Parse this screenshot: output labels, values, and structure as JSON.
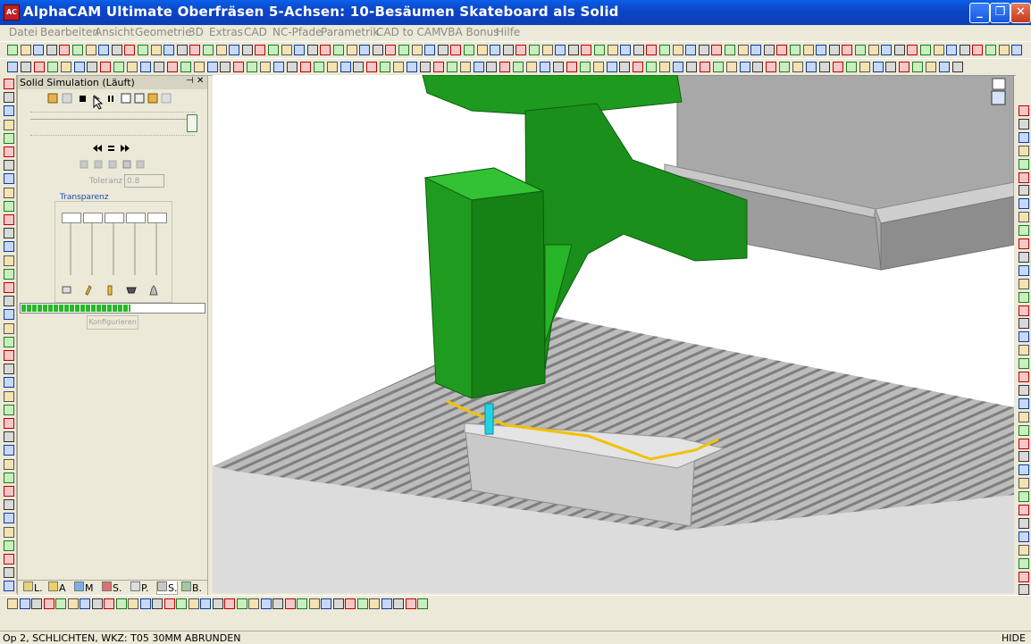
{
  "window": {
    "app_icon_text": "AC",
    "title": "AlphaCAM Ultimate Oberfräsen 5-Achsen: 10-Besäumen Skateboard als Solid",
    "btn_minimize": "_",
    "btn_maximize": "❐",
    "btn_close": "✕"
  },
  "menu": {
    "items": [
      "Datei",
      "Bearbeiten",
      "Ansicht",
      "Geometrie",
      "3D",
      "Extras",
      "CAD",
      "NC-Pfade",
      "Parametrik",
      "CAD to CAM",
      "VBA Bonus",
      "Hilfe"
    ]
  },
  "panel": {
    "title": "Solid Simulation (Läuft)",
    "pin": "⊣",
    "close": "✕",
    "toleranz_label": "Toleranz",
    "toleranz_value": "0.8",
    "transparenz_label": "Transparenz",
    "progress_fraction": 0.6,
    "konfigurieren_label": "Konfigurieren",
    "tabs": [
      "L.",
      "A",
      "M",
      "S.",
      "P.",
      "S.",
      "B."
    ]
  },
  "status": {
    "text": "Op 2, SCHLICHTEN, WKZ: T05 30MM ABRUNDEN",
    "hide": "HIDE"
  },
  "colors": {
    "titlebar": "#0b46c8",
    "machine_green": "#1e9a1e",
    "tool_cyan": "#22d3e6",
    "toolpath_yellow": "#f2c200",
    "bed_gray": "#9a9a9a"
  },
  "icons": {
    "play": "play-icon",
    "stop": "stop-icon",
    "pause": "pause-icon",
    "rewind": "rewind-icon",
    "forward": "fast-forward-icon"
  }
}
